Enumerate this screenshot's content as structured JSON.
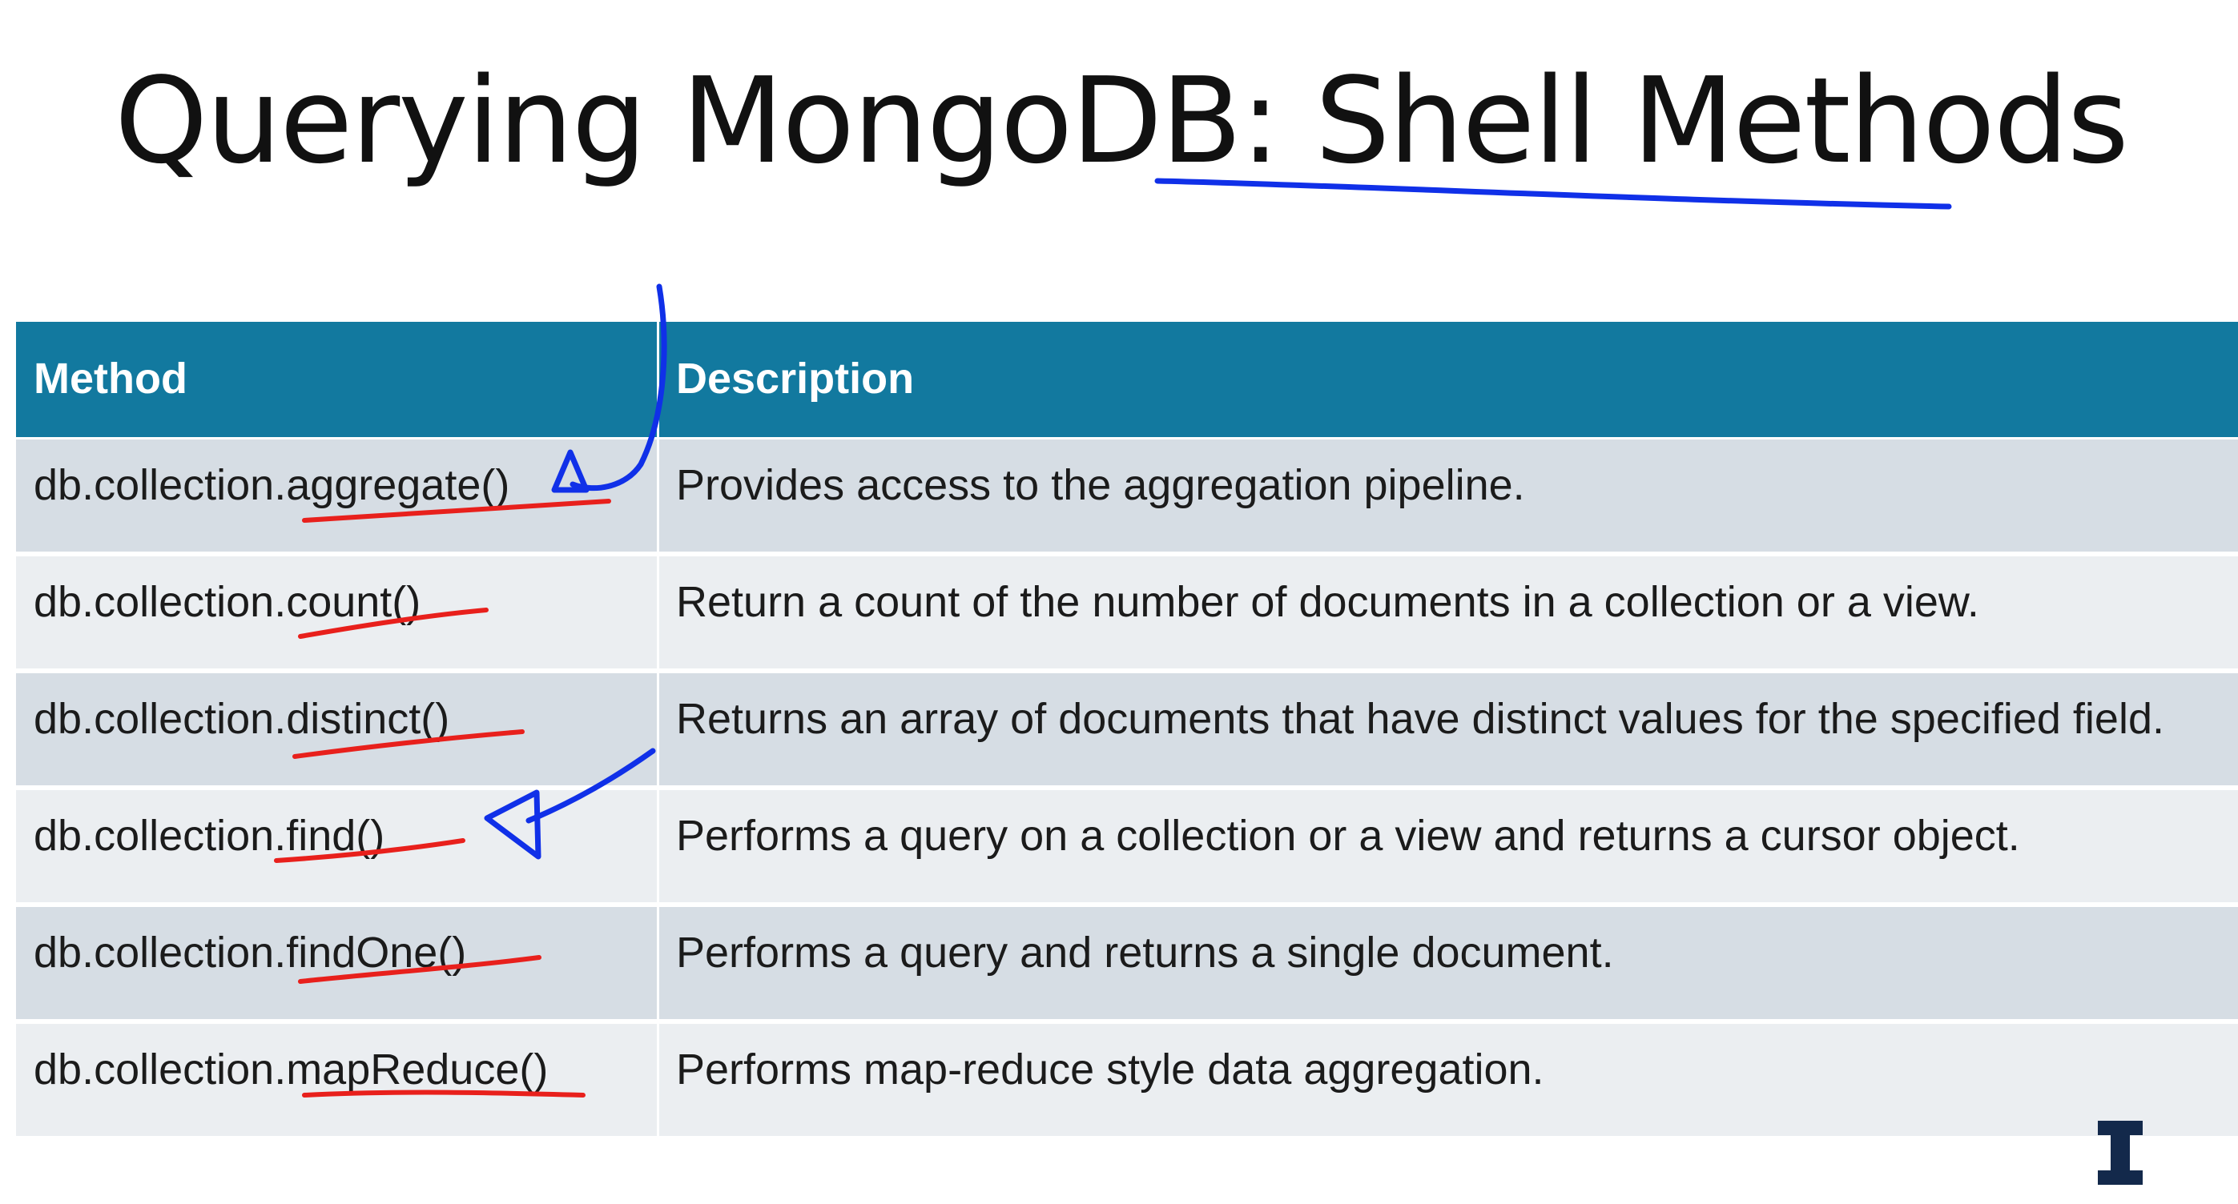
{
  "slide": {
    "title": "Querying MongoDB: Shell Methods"
  },
  "table": {
    "headers": {
      "method": "Method",
      "description": "Description"
    },
    "rows": [
      {
        "method": "db.collection.aggregate()",
        "description": "Provides access to the aggregation pipeline."
      },
      {
        "method": "db.collection.count()",
        "description": "Return a count of the number of documents in a collection or a view."
      },
      {
        "method": "db.collection.distinct()",
        "description": "Returns an array of documents that have distinct values for the specified field."
      },
      {
        "method": "db.collection.find()",
        "description": "Performs a query on a collection or a view and returns a cursor object."
      },
      {
        "method": "db.collection.findOne()",
        "description": "Performs a query and returns a single document."
      },
      {
        "method": "db.collection.mapReduce()",
        "description": "Performs map-reduce style data aggregation."
      }
    ]
  },
  "colors": {
    "header_bg": "#12799f",
    "row_odd_bg": "#d6dde4",
    "row_even_bg": "#ebeef1",
    "annotation_blue": "#1030e8",
    "annotation_red": "#e8201c",
    "logo_color": "#13294b"
  },
  "icons": {
    "logo": "university-block-i-logo"
  }
}
